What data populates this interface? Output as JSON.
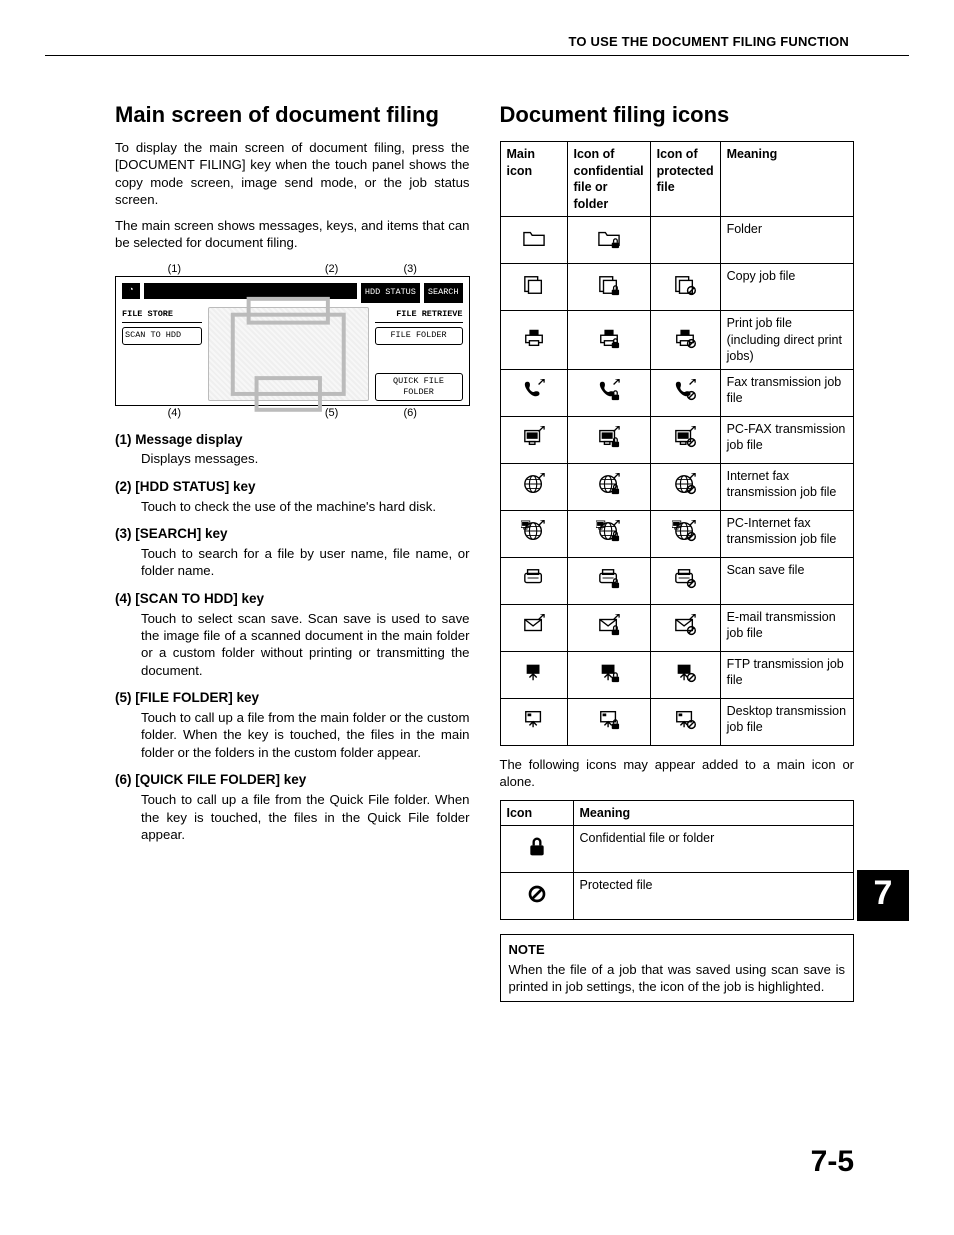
{
  "running_head": "TO USE THE DOCUMENT FILING FUNCTION",
  "page_tab": "7",
  "page_number": "7-5",
  "left": {
    "heading": "Main screen of document filing",
    "para1": "To display the main screen of document filing, press the [DOCUMENT FILING] key when the touch panel shows the copy mode screen, image send mode, or the job status screen.",
    "para2": "The main screen shows messages, keys, and items that can be selected for document filing.",
    "diagram": {
      "top_labels": [
        "(1)",
        "(2)",
        "(3)"
      ],
      "bottom_labels": [
        "(4)",
        "(5)",
        "(6)"
      ],
      "top_btn_hdd": "HDD STATUS",
      "top_btn_search": "SEARCH",
      "left_header": "FILE STORE",
      "left_btn": "SCAN TO HDD",
      "right_btn1": "FILE RETRIEVE",
      "right_btn2": "FILE FOLDER",
      "right_btn3": "QUICK FILE FOLDER"
    },
    "legend": [
      {
        "n": "(1)",
        "title": "Message display",
        "body": "Displays messages."
      },
      {
        "n": "(2)",
        "title": "[HDD STATUS] key",
        "body": "Touch to check the use of the machine's hard disk."
      },
      {
        "n": "(3)",
        "title": "[SEARCH] key",
        "body": "Touch to search for a file by user name, file name, or folder name."
      },
      {
        "n": "(4)",
        "title": "[SCAN TO HDD] key",
        "body": "Touch to select scan save. Scan save is used to save the image file of a scanned document in the main folder or a custom folder without printing or transmitting the document."
      },
      {
        "n": "(5)",
        "title": "[FILE FOLDER] key",
        "body": "Touch to call up a file from the main folder or the custom folder. When the key is touched, the files in the main folder or the folders in the custom folder appear."
      },
      {
        "n": "(6)",
        "title": "[QUICK FILE FOLDER] key",
        "body": "Touch to call up a file from the Quick File folder. When the key is touched, the files in the Quick File folder appear."
      }
    ]
  },
  "right": {
    "heading": "Document filing icons",
    "table_headers": {
      "c1": "Main icon",
      "c2": "Icon of confidential file or folder",
      "c3": "Icon of protected file",
      "c4": "Meaning"
    },
    "rows": [
      {
        "id": "folder",
        "protected": false,
        "meaning": "Folder"
      },
      {
        "id": "copy",
        "protected": true,
        "meaning": "Copy job file"
      },
      {
        "id": "print",
        "protected": true,
        "meaning": "Print job file (including direct print jobs)"
      },
      {
        "id": "fax",
        "protected": true,
        "meaning": "Fax transmission job file"
      },
      {
        "id": "pcfax",
        "protected": true,
        "meaning": "PC-FAX transmission job file"
      },
      {
        "id": "ifax",
        "protected": true,
        "meaning": "Internet fax transmission job file"
      },
      {
        "id": "pcifax",
        "protected": true,
        "meaning": "PC-Internet fax transmission job file"
      },
      {
        "id": "scan",
        "protected": true,
        "meaning": "Scan save file"
      },
      {
        "id": "email",
        "protected": true,
        "meaning": "E-mail transmission job file"
      },
      {
        "id": "ftp",
        "protected": true,
        "meaning": "FTP transmission job file"
      },
      {
        "id": "desktop",
        "protected": true,
        "meaning": "Desktop transmission job file"
      }
    ],
    "after_table": "The following icons may appear added to a main icon or alone.",
    "badge_table": {
      "headers": {
        "c1": "Icon",
        "c2": "Meaning"
      },
      "rows": [
        {
          "id": "lock",
          "meaning": "Confidential file or folder"
        },
        {
          "id": "prohibit",
          "meaning": "Protected file"
        }
      ]
    },
    "note": {
      "header": "NOTE",
      "body": "When the file of a job that was saved using scan save is printed in job settings, the icon of the job is highlighted."
    }
  }
}
